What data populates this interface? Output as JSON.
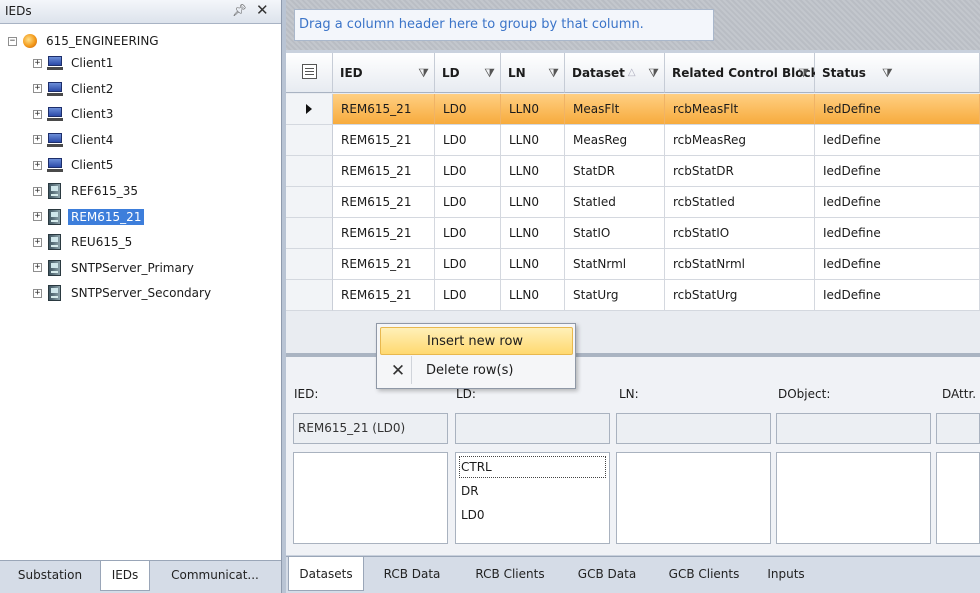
{
  "left_panel": {
    "title": "IEDs",
    "pin_icon": "14",
    "tree": {
      "root": "615_ENGINEERING",
      "children": [
        {
          "label": "Client1",
          "icon": "computer-icon"
        },
        {
          "label": "Client2",
          "icon": "computer-icon"
        },
        {
          "label": "Client3",
          "icon": "computer-icon"
        },
        {
          "label": "Client4",
          "icon": "computer-icon"
        },
        {
          "label": "Client5",
          "icon": "computer-icon"
        },
        {
          "label": "REF615_35",
          "icon": "ied-device-icon"
        },
        {
          "label": "REM615_21",
          "icon": "ied-device-icon",
          "selected": true
        },
        {
          "label": "REU615_5",
          "icon": "ied-device-icon"
        },
        {
          "label": "SNTPServer_Primary",
          "icon": "ied-device-icon"
        },
        {
          "label": "SNTPServer_Secondary",
          "icon": "ied-device-icon"
        }
      ]
    },
    "tabs": [
      "Substation",
      "IEDs",
      "Communicat..."
    ],
    "active_tab": "IEDs"
  },
  "grid": {
    "group_by_hint": "Drag a column header here to group by that column.",
    "columns": [
      "IED",
      "LD",
      "LN",
      "Dataset",
      "Related Control Blocks",
      "Status"
    ],
    "rows": [
      [
        "REM615_21",
        "LD0",
        "LLN0",
        "MeasFlt",
        "rcbMeasFlt",
        "IedDefine"
      ],
      [
        "REM615_21",
        "LD0",
        "LLN0",
        "MeasReg",
        "rcbMeasReg",
        "IedDefine"
      ],
      [
        "REM615_21",
        "LD0",
        "LLN0",
        "StatDR",
        "rcbStatDR",
        "IedDefine"
      ],
      [
        "REM615_21",
        "LD0",
        "LLN0",
        "StatIed",
        "rcbStatIed",
        "IedDefine"
      ],
      [
        "REM615_21",
        "LD0",
        "LLN0",
        "StatIO",
        "rcbStatIO",
        "IedDefine"
      ],
      [
        "REM615_21",
        "LD0",
        "LLN0",
        "StatNrml",
        "rcbStatNrml",
        "IedDefine"
      ],
      [
        "REM615_21",
        "LD0",
        "LLN0",
        "StatUrg",
        "rcbStatUrg",
        "IedDefine"
      ]
    ],
    "selected_row": 0
  },
  "context_menu": {
    "items": [
      {
        "label": "Insert new row",
        "highlighted": true
      },
      {
        "label": "Delete row(s)",
        "icon": "delete-icon"
      }
    ]
  },
  "editor": {
    "labels": {
      "ied": "IED:",
      "ld": "LD:",
      "ln": "LN:",
      "dobject": "DObject:",
      "dattr": "DAttr."
    },
    "ied_value": "REM615_21 (LD0)",
    "ld_list": [
      "CTRL",
      "DR",
      "LD0"
    ]
  },
  "bottom_tabs": [
    "Datasets",
    "RCB Data",
    "RCB Clients",
    "GCB Data",
    "GCB Clients",
    "Inputs"
  ],
  "active_bottom_tab": "Datasets",
  "colors": {
    "selection": "#3d7edb",
    "row_highlight": "#f7ab3d",
    "hint_text": "#3b74c8"
  }
}
